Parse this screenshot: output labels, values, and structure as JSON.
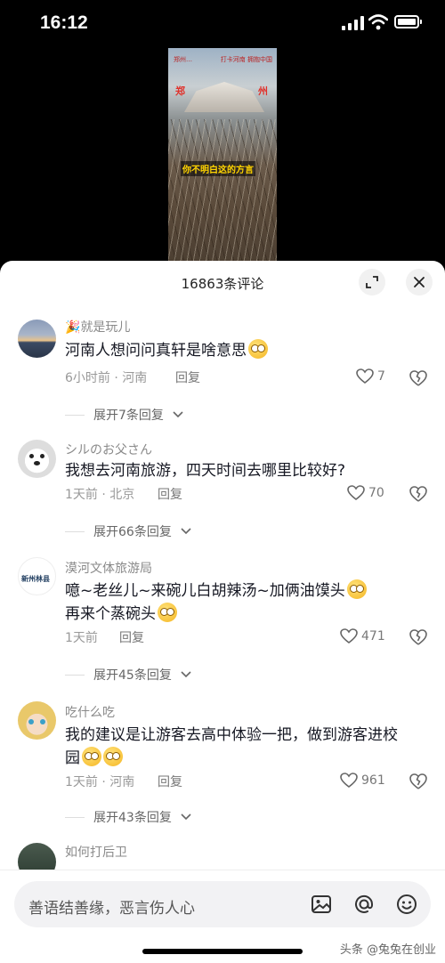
{
  "status_bar": {
    "time": "16:12"
  },
  "video": {
    "logo_left": "郑州…",
    "logo_right": "打卡河南 拥抱中国",
    "city_left": "郑",
    "city_right": "州",
    "caption": "你不明白这的方言"
  },
  "panel": {
    "comment_count": "16863条评论",
    "expand_icon": "fullscreen-icon",
    "close_icon": "close-icon"
  },
  "comments": [
    {
      "user": "就是玩儿",
      "user_badge": "🎉",
      "text": "河南人想问问真轩是啥意思",
      "emoji_count": 1,
      "time_location": "6小时前 · 河南",
      "reply": "回复",
      "likes": "7",
      "expand": "展开7条回复"
    },
    {
      "user": "シルのお父さん",
      "text": "我想去河南旅游，四天时间去哪里比较好?",
      "emoji_count": 0,
      "time_location": "1天前 · 北京",
      "reply": "回复",
      "likes": "70",
      "expand": "展开66条回复"
    },
    {
      "user": "漠河文体旅游局",
      "text_line1": "噫~老丝儿~来碗儿白胡辣汤~加俩油馍头",
      "text_line2": "再来个蒸碗头",
      "avatar_text": "新州林县",
      "time_location": "1天前",
      "reply": "回复",
      "likes": "471",
      "expand": "展开45条回复"
    },
    {
      "user": "吃什么吃",
      "text_line1": "我的建议是让游客去高中体验一把，做到游客进校",
      "text_line2": "园",
      "time_location": "1天前 · 河南",
      "reply": "回复",
      "likes": "961",
      "expand": "展开43条回复"
    },
    {
      "user": "如何打后卫"
    }
  ],
  "input": {
    "placeholder": "善语结善缘，恶言伤人心",
    "icons": [
      "image-icon",
      "at-icon",
      "emoji-icon"
    ]
  },
  "watermark": "头条 @兔兔在创业"
}
